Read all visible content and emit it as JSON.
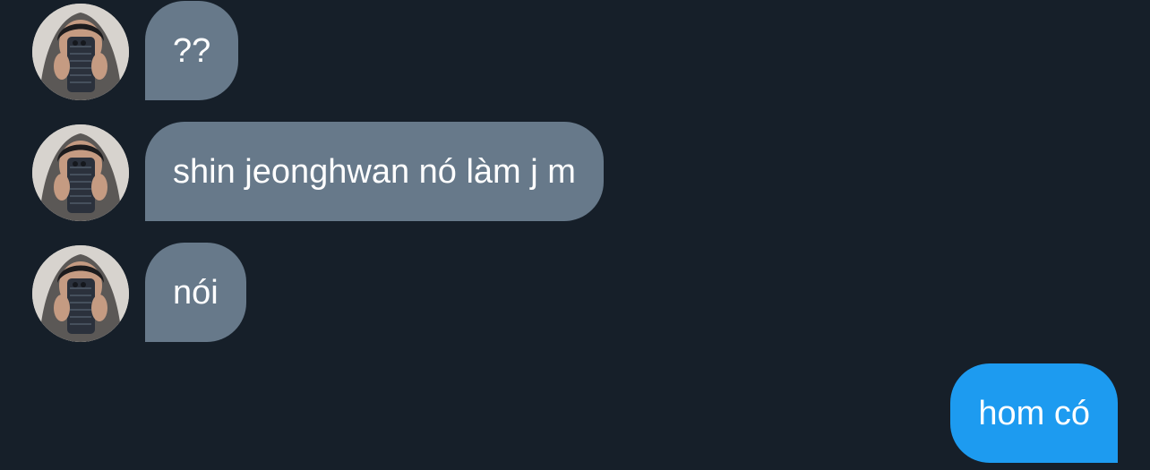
{
  "conversation": {
    "messages": [
      {
        "direction": "incoming",
        "text": "??",
        "avatar_icon": "user-avatar"
      },
      {
        "direction": "incoming",
        "text": "shin jeonghwan nó làm j m",
        "avatar_icon": "user-avatar"
      },
      {
        "direction": "incoming",
        "text": "nói",
        "avatar_icon": "user-avatar"
      },
      {
        "direction": "outgoing",
        "text": "hom có"
      }
    ]
  },
  "colors": {
    "background": "#161f29",
    "incoming_bubble": "#67798a",
    "outgoing_bubble": "#1d9bf0",
    "text": "#ffffff"
  }
}
